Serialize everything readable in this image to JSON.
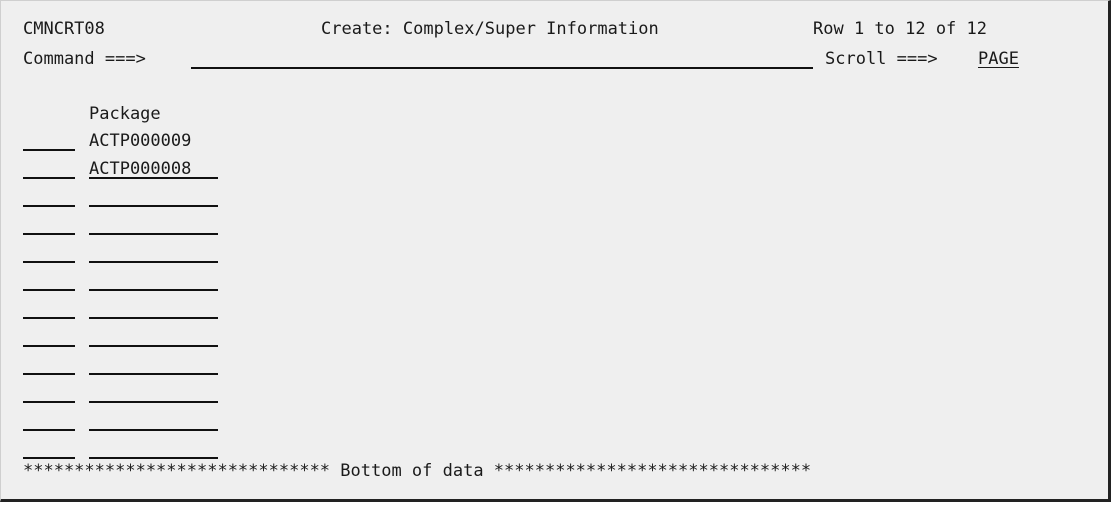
{
  "header": {
    "panel_id": "CMNCRT08",
    "title": "Create: Complex/Super Information",
    "row_info": "Row 1 to 12 of 12",
    "command_label": "Command ===>",
    "command_value": "",
    "scroll_label": "Scroll ===>",
    "scroll_value": "PAGE"
  },
  "table": {
    "column_header": "Package",
    "rows": [
      {
        "sel": "",
        "package": "ACTP000009"
      },
      {
        "sel": "",
        "package": "ACTP000008"
      },
      {
        "sel": "",
        "package": ""
      },
      {
        "sel": "",
        "package": ""
      },
      {
        "sel": "",
        "package": ""
      },
      {
        "sel": "",
        "package": ""
      },
      {
        "sel": "",
        "package": ""
      },
      {
        "sel": "",
        "package": ""
      },
      {
        "sel": "",
        "package": ""
      },
      {
        "sel": "",
        "package": ""
      },
      {
        "sel": "",
        "package": ""
      },
      {
        "sel": "",
        "package": ""
      }
    ]
  },
  "footer": {
    "bottom_text": "****************************** Bottom of data *******************************"
  }
}
